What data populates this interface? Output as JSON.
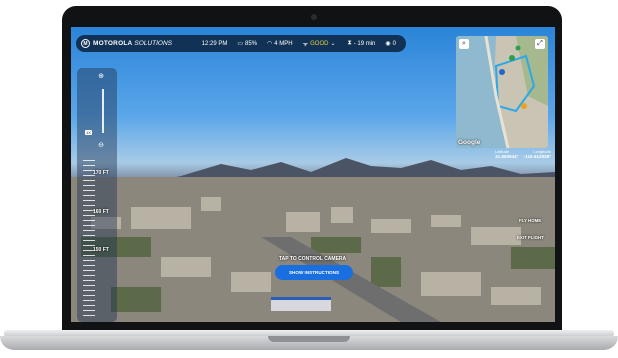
{
  "brand": {
    "logo_letter": "M",
    "name": "MOTOROLA",
    "sub": "SOLUTIONS"
  },
  "status": {
    "time": "12:29 PM",
    "battery": "85%",
    "speed": "4 MPH",
    "signal": "GOOD",
    "flight_time": "- 19 min",
    "viewers": "0"
  },
  "map": {
    "logo": "Google"
  },
  "coords": {
    "latitude_label": "Latitude",
    "longitude_label": "Longitude",
    "latitude": "31.960944°",
    "longitude": "-116.612838°"
  },
  "altitude": {
    "zoom_label": "1X",
    "ticks": [
      "170 FT",
      "160 FT",
      "150 FT"
    ]
  },
  "actions": {
    "fly_home": "FLY HOME",
    "exit_flight": "EXIT FLIGHT",
    "tap_text": "TAP TO CONTROL CAMERA",
    "show_instructions": "SHOW INSTRUCTIONS"
  },
  "icons": {
    "battery": "battery-icon",
    "speed": "speedometer-icon",
    "signal": "signal-icon",
    "timer": "hourglass-icon",
    "viewers": "eye-icon",
    "zoom_in": "zoom-in-icon",
    "zoom_out": "zoom-out-icon"
  }
}
